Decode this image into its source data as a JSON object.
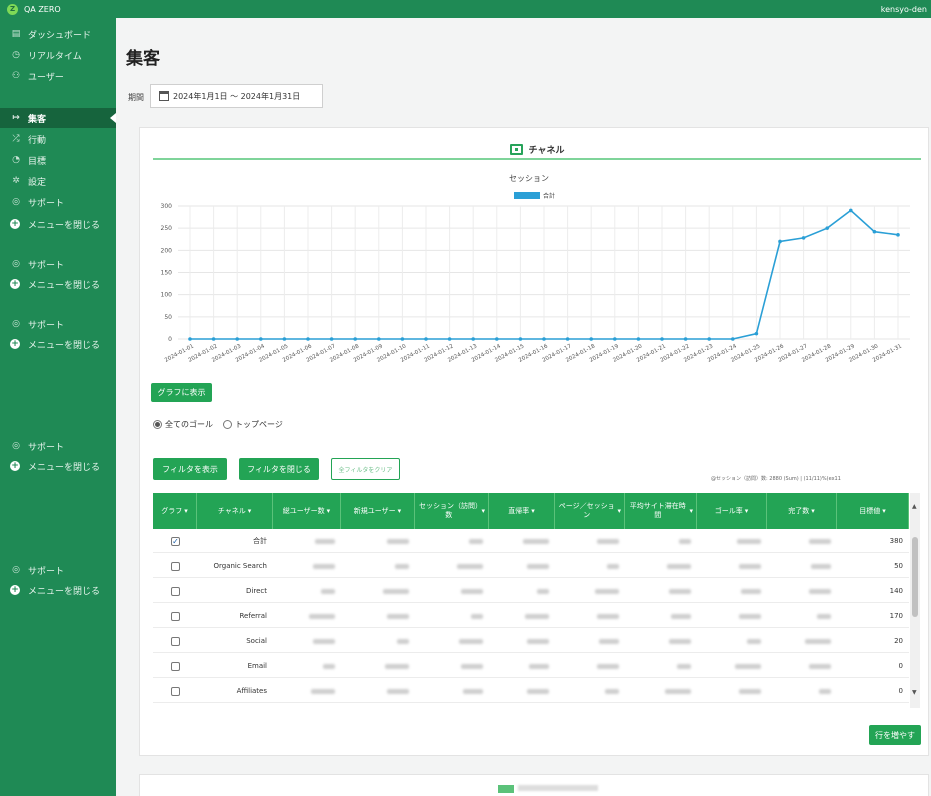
{
  "app": {
    "brand": "QA ZERO",
    "logo_letter": "Z",
    "user": "kensyo-den"
  },
  "sidebar": {
    "items": [
      {
        "label": "ダッシュボード",
        "icon": "dashboard-icon",
        "glyph": "▤"
      },
      {
        "label": "リアルタイム",
        "icon": "clock-icon",
        "glyph": "◷"
      },
      {
        "label": "ユーザー",
        "icon": "user-icon",
        "glyph": "⚇"
      },
      {
        "label": "集客",
        "icon": "enter-icon",
        "glyph": "↦",
        "active": true
      },
      {
        "label": "行動",
        "icon": "behavior-icon",
        "glyph": "⤮"
      },
      {
        "label": "目標",
        "icon": "goal-icon",
        "glyph": "◔"
      },
      {
        "label": "設定",
        "icon": "gear-icon",
        "glyph": "✲"
      },
      {
        "label": "サポート",
        "icon": "support-icon",
        "glyph": "◎"
      }
    ],
    "support_label": "サポート",
    "collapse_label": "メニューを閉じる"
  },
  "page": {
    "title": "集客"
  },
  "period": {
    "label": "期間",
    "value": "2024年1月1日 ～ 2024年1月31日"
  },
  "channel_section": {
    "title": "チャネル"
  },
  "chart_data": {
    "type": "line",
    "title": "セッション",
    "legend": [
      "合計"
    ],
    "legend_position": "top",
    "grid": true,
    "ylim": [
      0,
      300
    ],
    "yticks": [
      0,
      50,
      100,
      150,
      200,
      250,
      300
    ],
    "color": "#2a9fd6",
    "x": [
      "2024-01-01",
      "2024-01-02",
      "2024-01-03",
      "2024-01-04",
      "2024-01-05",
      "2024-01-06",
      "2024-01-07",
      "2024-01-08",
      "2024-01-09",
      "2024-01-10",
      "2024-01-11",
      "2024-01-12",
      "2024-01-13",
      "2024-01-14",
      "2024-01-15",
      "2024-01-16",
      "2024-01-17",
      "2024-01-18",
      "2024-01-19",
      "2024-01-20",
      "2024-01-21",
      "2024-01-22",
      "2024-01-23",
      "2024-01-24",
      "2024-01-25",
      "2024-01-26",
      "2024-01-27",
      "2024-01-28",
      "2024-01-29",
      "2024-01-30",
      "2024-01-31"
    ],
    "series": [
      {
        "name": "合計",
        "values": [
          0,
          0,
          0,
          0,
          0,
          0,
          0,
          0,
          0,
          0,
          0,
          0,
          0,
          0,
          0,
          0,
          0,
          0,
          0,
          0,
          0,
          0,
          0,
          0,
          12,
          220,
          228,
          250,
          290,
          242,
          235
        ]
      }
    ]
  },
  "buttons": {
    "show_graph": "グラフに表示",
    "show_filter": "フィルタを表示",
    "close_filter": "フィルタを閉じる",
    "clear_filter": "全フィルタをクリア",
    "add_rows": "行を増やす"
  },
  "goal_radio": {
    "all_goals": "全てのゴール",
    "top_page": "トップページ"
  },
  "summary_text": "@セッション（訪問）数: 2880 (Sum) | (11/11)%(ex11",
  "table": {
    "headers": [
      "グラフ",
      "チャネル",
      "総ユーザー数",
      "新規ユーザー",
      "セッション（訪問）数",
      "直帰率",
      "ページ／セッション",
      "平均サイト滞在時間",
      "ゴール率",
      "完了数",
      "目標値"
    ],
    "sort_glyph": "▾",
    "rows": [
      {
        "checked": true,
        "channel": "合計",
        "goal_value": "380"
      },
      {
        "checked": false,
        "channel": "Organic Search",
        "goal_value": "50"
      },
      {
        "checked": false,
        "channel": "Direct",
        "goal_value": "140"
      },
      {
        "checked": false,
        "channel": "Referral",
        "goal_value": "170"
      },
      {
        "checked": false,
        "channel": "Social",
        "goal_value": "20"
      },
      {
        "checked": false,
        "channel": "Email",
        "goal_value": "0"
      },
      {
        "checked": false,
        "channel": "Affiliates",
        "goal_value": "0"
      }
    ]
  }
}
